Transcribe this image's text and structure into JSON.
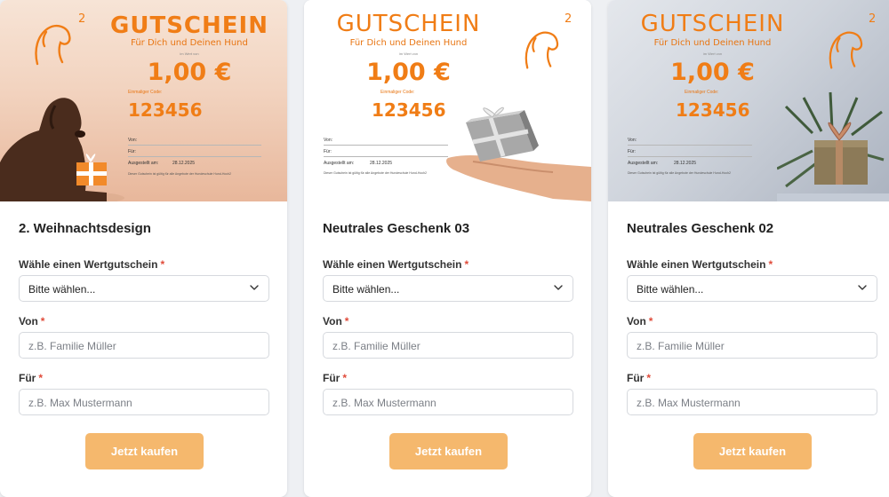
{
  "colors": {
    "accent": "#f07d16",
    "button": "#f5b86d",
    "required": "#e04b3a",
    "page_bg": "#eef0f3"
  },
  "form_labels": {
    "wert": "Wähle einen Wertgutschein",
    "von": "Von",
    "fuer": "Für",
    "required_mark": "*"
  },
  "form_values": {
    "select_value": "Bitte wählen...",
    "von_placeholder": "z.B. Familie Müller",
    "fuer_placeholder": "z.B. Max Mustermann",
    "buy_label": "Jetzt kaufen"
  },
  "voucher": {
    "title": "GUTSCHEIN",
    "subtitle": "Für Dich und Deinen Hund",
    "tiny_label": "im Wert von",
    "amount": "1,00 €",
    "code_label": "Einmaliger Code:",
    "code": "123456",
    "von_label": "Von:",
    "fuer_label": "Für:",
    "issued_label": "Ausgestellt am:",
    "issued_date": "28.12.2025",
    "note": "Dieser Gutschein ist gültig für alle Angebote der Hundeschule Hund-Hoch2",
    "logo_sup": "2"
  },
  "cards": [
    {
      "title": "2. Weihnachtsdesign",
      "image_icon": "dog-with-gift-image"
    },
    {
      "title": "Neutrales Geschenk 03",
      "image_icon": "hand-holding-gift-image"
    },
    {
      "title": "Neutrales Geschenk 02",
      "image_icon": "wrapped-gift-with-branches-image"
    }
  ]
}
